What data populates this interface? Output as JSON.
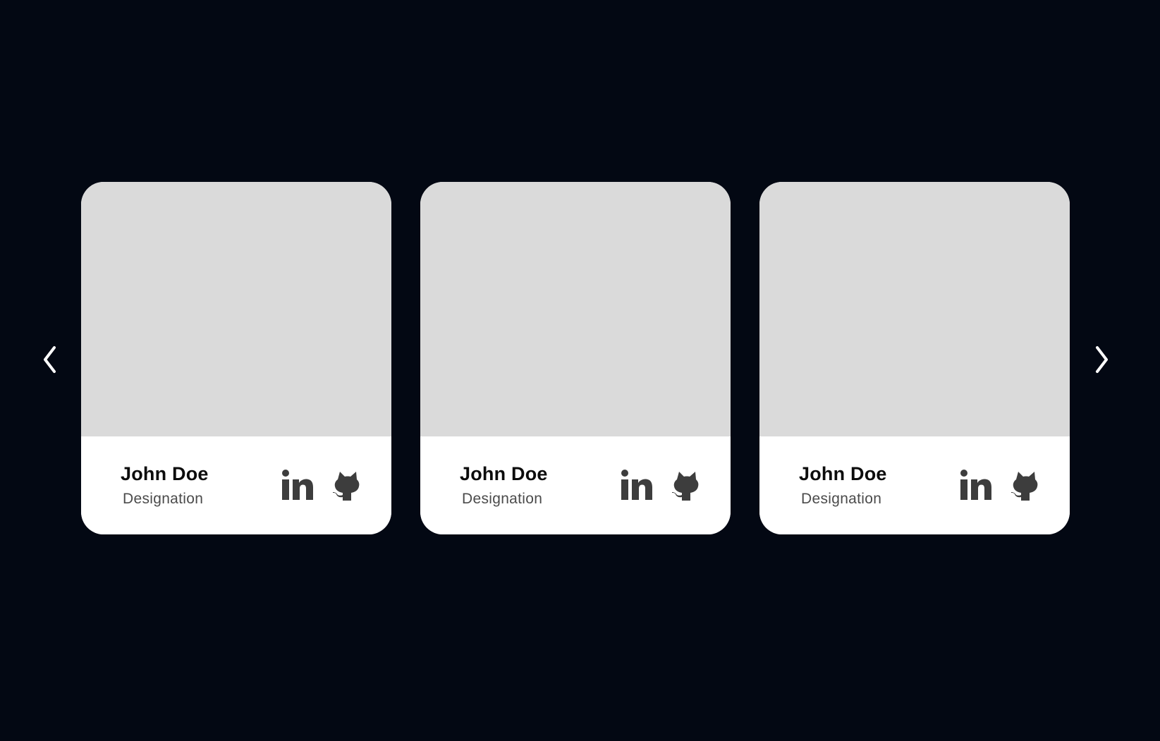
{
  "nav": {
    "prev_icon": "chevron-left-icon",
    "next_icon": "chevron-right-icon",
    "icon_color": "#ffffff"
  },
  "cards": [
    {
      "name": "John Doe",
      "designation": "Designation",
      "social": [
        "linkedin-icon",
        "github-icon"
      ]
    },
    {
      "name": "John Doe",
      "designation": "Designation",
      "social": [
        "linkedin-icon",
        "github-icon"
      ]
    },
    {
      "name": "John Doe",
      "designation": "Designation",
      "social": [
        "linkedin-icon",
        "github-icon"
      ]
    }
  ],
  "colors": {
    "background": "#030813",
    "card": "#ffffff",
    "image_placeholder": "#dadada",
    "icon": "#3d3d3d"
  }
}
